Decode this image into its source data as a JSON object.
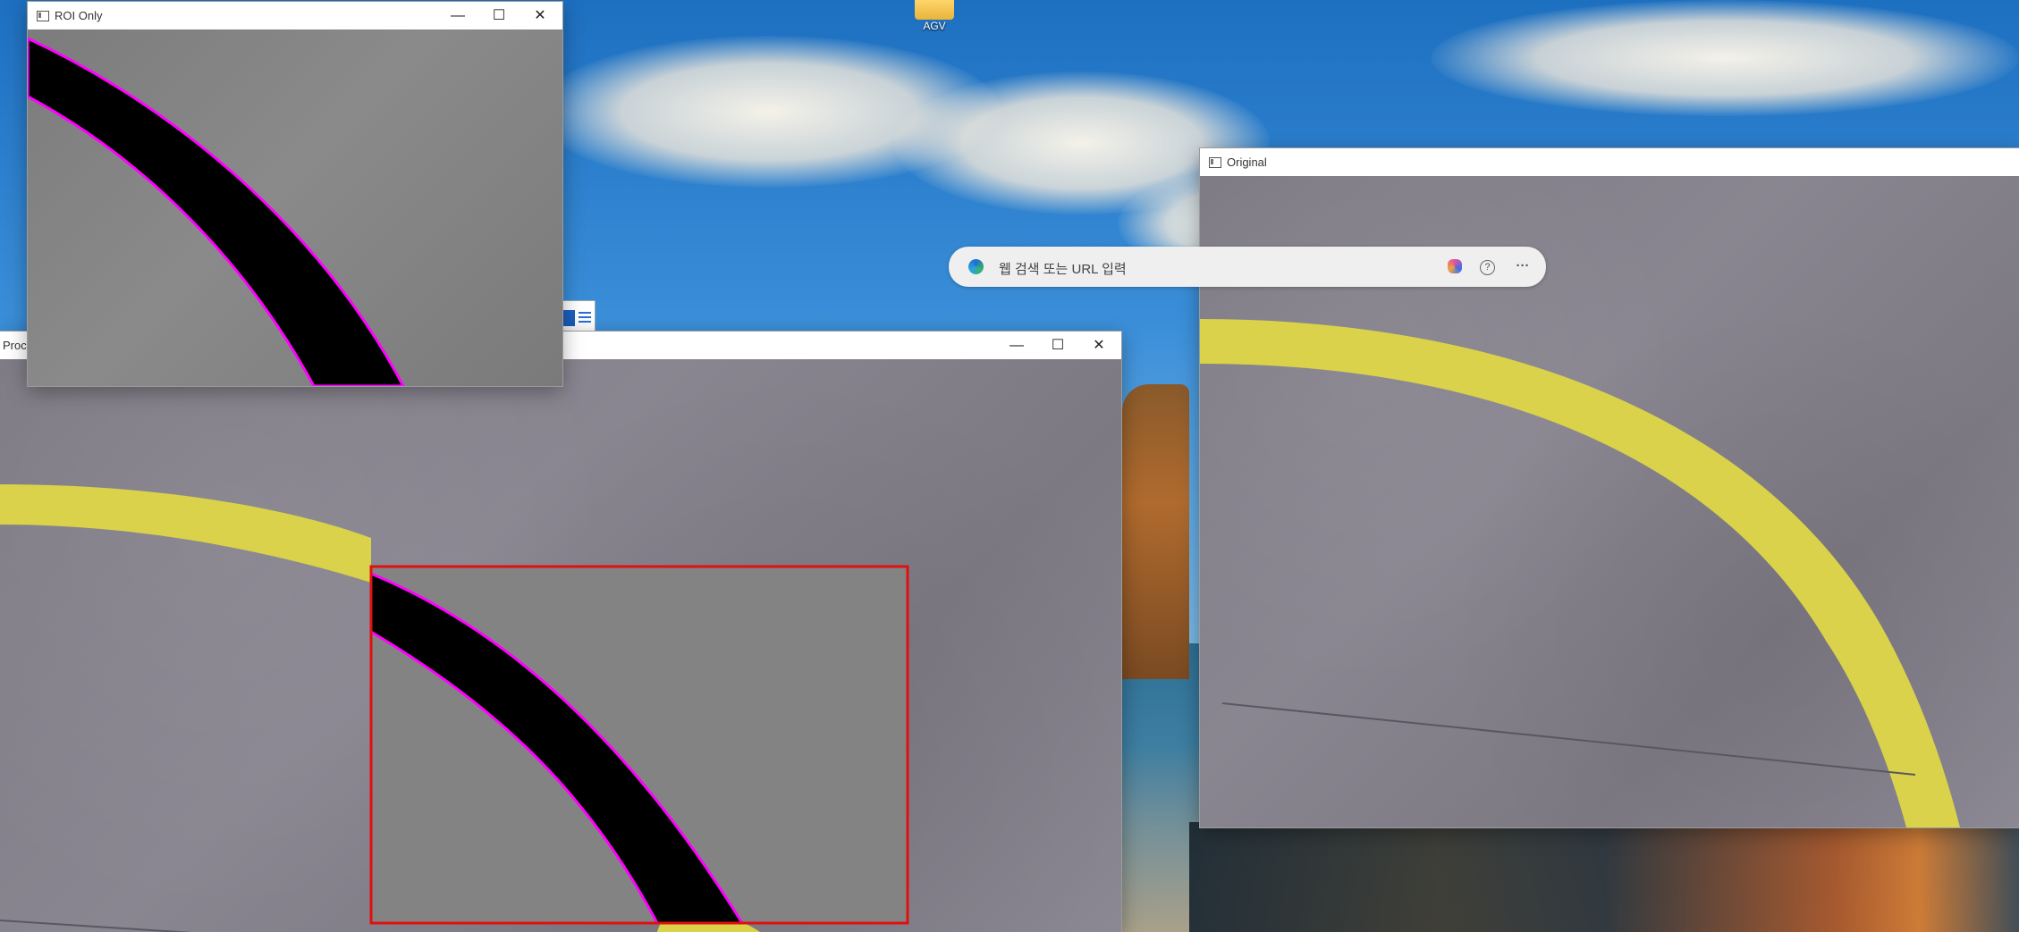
{
  "desktop": {
    "icons": [
      {
        "label": "AGV",
        "icon": "folder-icon"
      },
      {
        "label": "",
        "icon": "word-document-icon"
      }
    ]
  },
  "windows": {
    "roi": {
      "title": "ROI Only",
      "controls": {
        "minimize": "—",
        "maximize": "☐",
        "close": "✕"
      }
    },
    "processed": {
      "title": "Proc",
      "controls": {
        "minimize": "—",
        "maximize": "☐",
        "close": "✕"
      }
    },
    "original": {
      "title": "Original"
    }
  },
  "browser_bar": {
    "placeholder": "웹 검색 또는 URL 입력",
    "buttons": {
      "copilot": "copilot-icon",
      "help": "?",
      "more": "···"
    }
  },
  "colors": {
    "line_yellow": "#d9d24a",
    "mask_black": "#000000",
    "contour_magenta": "#ff00ff",
    "roi_red": "#e01010"
  }
}
